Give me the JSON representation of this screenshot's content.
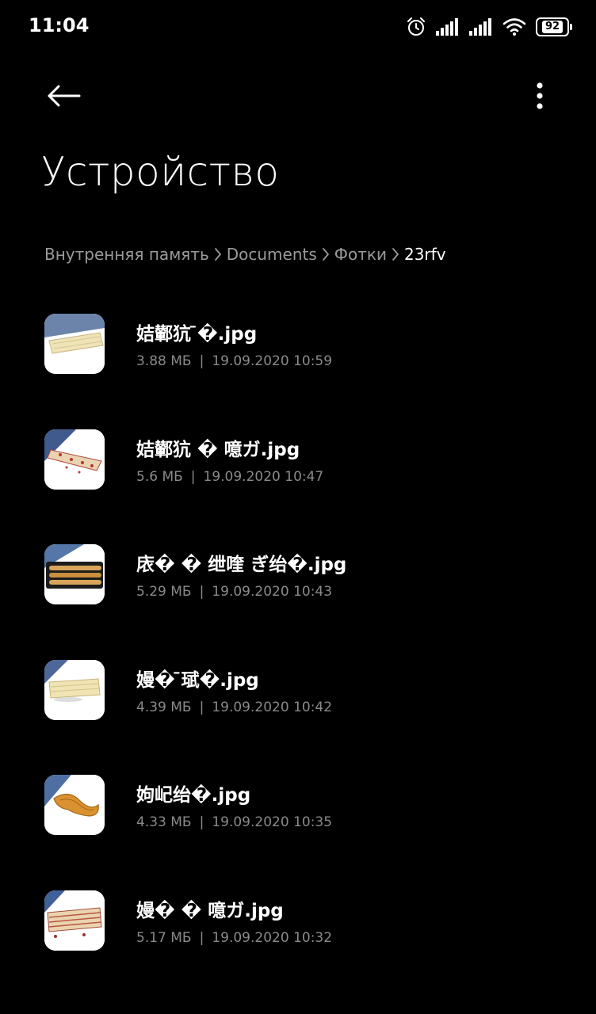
{
  "status_bar": {
    "time": "11:04",
    "battery_level": "92",
    "icons": [
      "alarm-icon",
      "signal-icon",
      "signal-icon",
      "wifi-icon",
      "battery-icon"
    ]
  },
  "toolbar": {
    "back_icon": "arrow-left-icon",
    "more_icon": "more-vertical-icon"
  },
  "page_title": "Устройство",
  "breadcrumb": [
    {
      "label": "Внутренняя память"
    },
    {
      "label": "Documents"
    },
    {
      "label": "Фотки"
    },
    {
      "label": "23rfv"
    }
  ],
  "files": [
    {
      "name": "姞鄻犺 ̄�.jpg",
      "size": "3.88 МБ",
      "date": "19.09.2020 10:59"
    },
    {
      "name": "姞鄻犺 � 噫ガ.jpg",
      "size": "5.6 МБ",
      "date": "19.09.2020 10:47"
    },
    {
      "name": "庡� � 绁喹 ぎ绐�.jpg",
      "size": "5.29 МБ",
      "date": "19.09.2020 10:43"
    },
    {
      "name": "嫚� ̄珷�.jpg",
      "size": "4.39 МБ",
      "date": "19.09.2020 10:42"
    },
    {
      "name": "姁屺绐�.jpg",
      "size": "4.33 МБ",
      "date": "19.09.2020 10:35"
    },
    {
      "name": "嫚� � 噫ガ.jpg",
      "size": "5.17 МБ",
      "date": "19.09.2020 10:32"
    }
  ],
  "meta_separator": "|",
  "colors": {
    "background": "#000000",
    "primary_text": "#ffffff",
    "secondary_text": "#8a8a8a",
    "thumb_accent": "#4a6a9c"
  }
}
